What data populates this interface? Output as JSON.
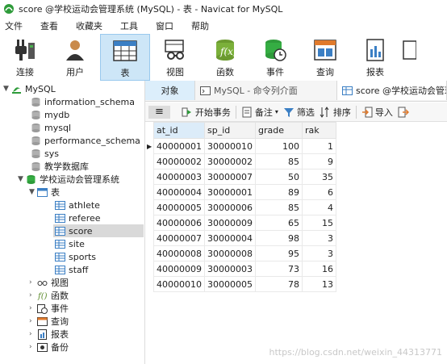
{
  "window": {
    "title": "score @学校运动会管理系统 (MySQL) - 表 - Navicat for MySQL"
  },
  "menu": [
    "文件",
    "查看",
    "收藏夹",
    "工具",
    "窗口",
    "帮助"
  ],
  "toolbar": {
    "items": [
      {
        "label": "连接",
        "icon": "plug-icon"
      },
      {
        "label": "用户",
        "icon": "user-icon"
      },
      {
        "label": "表",
        "icon": "table-icon",
        "active": true
      },
      {
        "label": "视图",
        "icon": "view-glasses-icon"
      },
      {
        "label": "函数",
        "icon": "function-icon"
      },
      {
        "label": "事件",
        "icon": "event-clock-icon"
      },
      {
        "label": "查询",
        "icon": "query-icon"
      },
      {
        "label": "报表",
        "icon": "report-icon"
      }
    ]
  },
  "tree": {
    "connection": "MySQL",
    "databases": [
      "information_schema",
      "mydb",
      "mysql",
      "performance_schema",
      "sys",
      "教学数据库",
      "学校运动会管理系统"
    ],
    "tables_label": "表",
    "tables": [
      "athlete",
      "referee",
      "score",
      "site",
      "sports",
      "staff"
    ],
    "selected_table": "score",
    "other_groups": [
      "视图",
      "函数",
      "事件",
      "查询",
      "报表",
      "备份"
    ]
  },
  "tabs": {
    "objects": "对象",
    "console": "MySQL - 命令列介面",
    "score": "score @学校运动会管理"
  },
  "subtoolbar": {
    "begin_transaction": "开始事务",
    "memo": "备注",
    "filter": "筛选",
    "sort": "排序",
    "import": "导入"
  },
  "grid": {
    "columns": [
      "at_id",
      "sp_id",
      "grade",
      "rak"
    ],
    "rows": [
      [
        "40000001",
        "30000010",
        "100",
        "1"
      ],
      [
        "40000002",
        "30000002",
        "85",
        "9"
      ],
      [
        "40000003",
        "30000007",
        "50",
        "35"
      ],
      [
        "40000004",
        "30000001",
        "89",
        "6"
      ],
      [
        "40000005",
        "30000006",
        "85",
        "4"
      ],
      [
        "40000006",
        "30000009",
        "65",
        "15"
      ],
      [
        "40000007",
        "30000004",
        "98",
        "3"
      ],
      [
        "40000008",
        "30000008",
        "95",
        "3"
      ],
      [
        "40000009",
        "30000003",
        "73",
        "16"
      ],
      [
        "40000010",
        "30000005",
        "78",
        "13"
      ]
    ]
  },
  "watermark": "https://blog.csdn.net/weixin_44313771",
  "colors": {
    "accent": "#cde6f7",
    "db_green": "#2e9b3a",
    "selected_row": "#d9d9d9"
  }
}
